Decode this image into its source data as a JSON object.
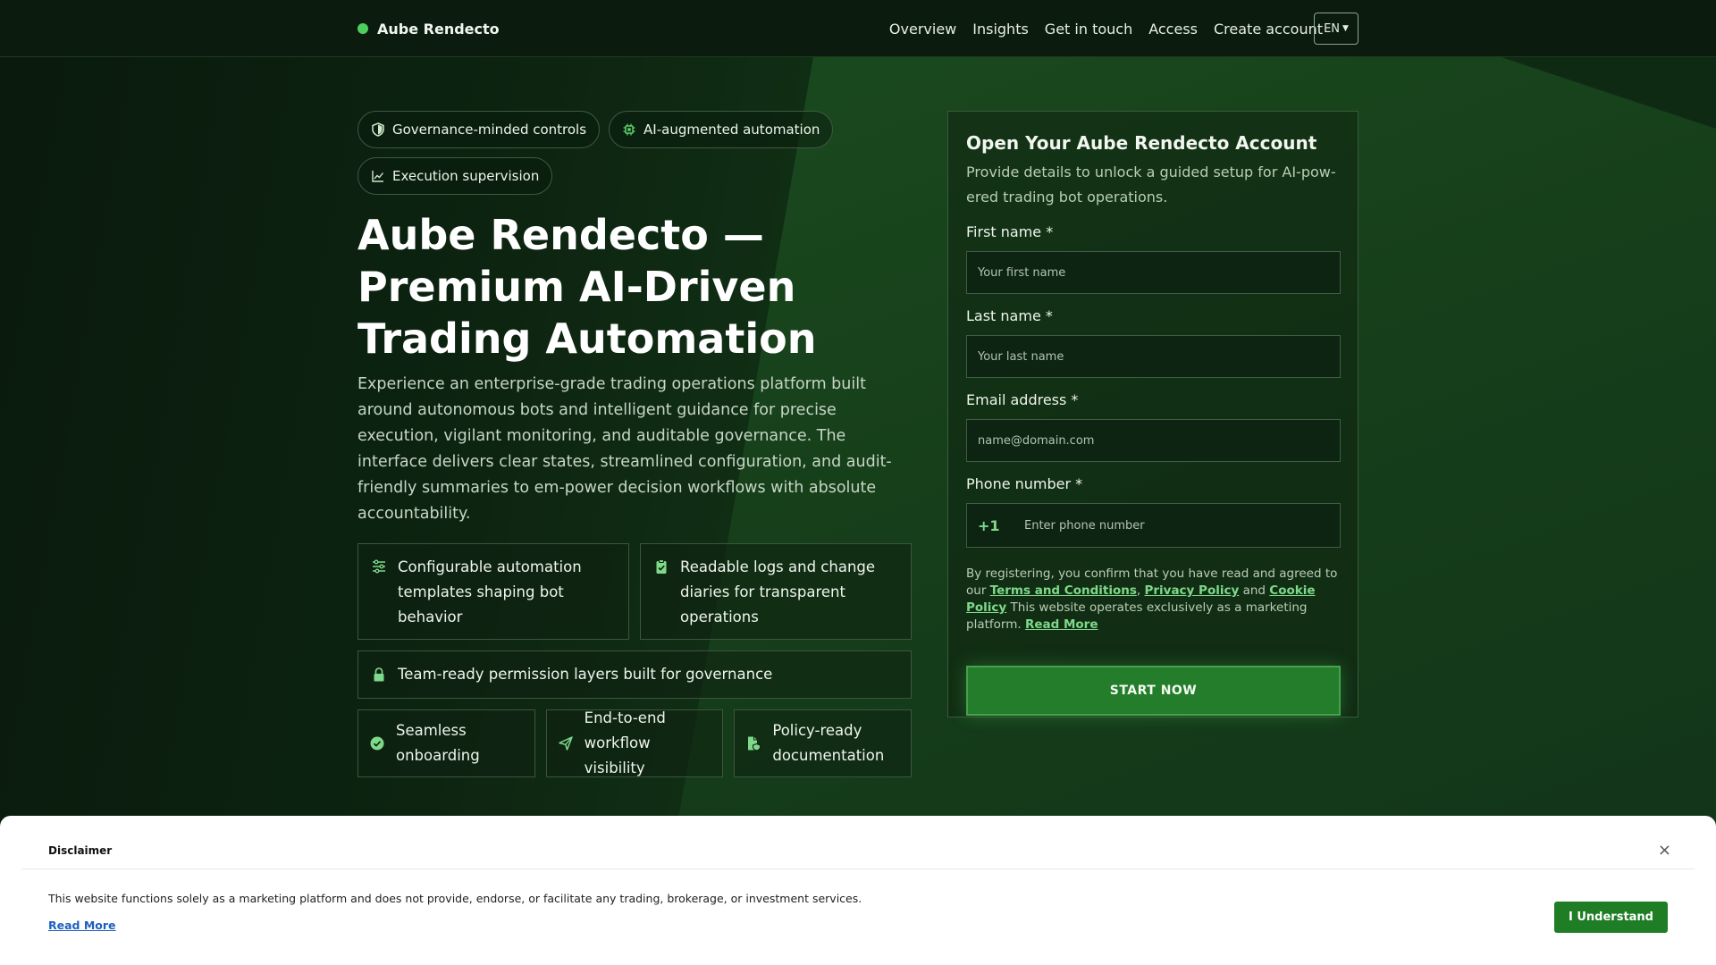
{
  "header": {
    "brand": "Aube Rendecto",
    "nav": [
      "Overview",
      "Insights",
      "Get in touch",
      "Access",
      "Create account"
    ],
    "lang": "EN"
  },
  "hero": {
    "chips": [
      "Governance-minded controls",
      "AI-augmented automation",
      "Execution supervision"
    ],
    "title": "Aube Rendecto — Premium AI-Driven Trading Automation",
    "description": "Experience an enterprise-grade trading operations platform built around autonomous bots and intelligent guidance for precise execution, vigilant monitoring, and auditable governance. The interface delivers clear states, streamlined configuration, and audit-friendly summaries to em-power decision workflows with absolute accountability.",
    "features": {
      "templates": "Configurable automation templates shaping bot behavior",
      "logs": "Readable logs and change diaries for transparent operations",
      "permissions": "Team-ready permission layers built for governance",
      "onboarding": "Seamless onboarding",
      "visibility": "End-to-end workflow visibility",
      "documentation": "Policy-ready documentation"
    }
  },
  "form": {
    "title": "Open Your Aube Rendecto Account",
    "subtitle": "Provide details to unlock a guided setup for AI-pow-ered trading bot operations.",
    "first_name_label": "First name *",
    "first_name_placeholder": "Your first name",
    "last_name_label": "Last name *",
    "last_name_placeholder": "Your last name",
    "email_label": "Email address *",
    "email_placeholder": "name@domain.com",
    "phone_label": "Phone number *",
    "phone_code": "+1",
    "phone_placeholder": "Enter phone number",
    "consent_prefix": "By registering, you confirm that you have read and agreed to our",
    "terms": "Terms and Conditions",
    "privacy": "Privacy Policy",
    "and": "and",
    "cookie": "Cookie Policy",
    "consent_suffix": "This website operates exclusively as a marketing platform.",
    "read_more": "Read More",
    "submit": "START NOW"
  },
  "disclaimer": {
    "title": "Disclaimer",
    "text": "This website functions solely as a marketing platform and does not provide, endorse, or facilitate any trading, brokerage, or investment services.",
    "read_more": "Read More",
    "close": "×",
    "button": "I Understand"
  },
  "colors": {
    "accent": "#4ecf5d",
    "button": "#237d2a",
    "disclaimer_button": "#1e7d25",
    "link": "#7fd98a"
  },
  "icons": {
    "brand": "dot-icon",
    "chip_governance": "shield-icon",
    "chip_ai": "chip-icon",
    "chip_execution": "line-chart-icon",
    "templates": "sliders-icon",
    "logs": "clipboard-check-icon",
    "permissions": "lock-icon",
    "onboarding": "check-circle-icon",
    "visibility": "send-icon",
    "documentation": "file-shield-icon",
    "close": "close-icon"
  }
}
